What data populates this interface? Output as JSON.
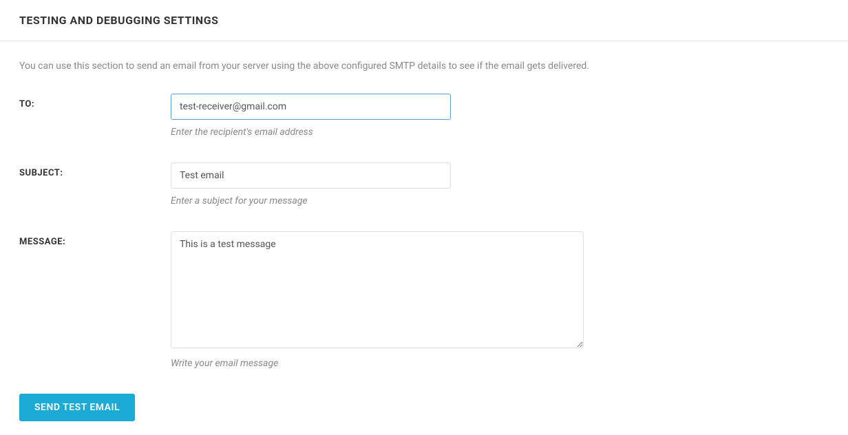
{
  "section": {
    "title": "TESTING AND DEBUGGING SETTINGS",
    "description": "You can use this section to send an email from your server using the above configured SMTP details to see if the email gets delivered."
  },
  "form": {
    "to": {
      "label": "TO:",
      "value": "test-receiver@gmail.com",
      "helper": "Enter the recipient's email address"
    },
    "subject": {
      "label": "SUBJECT:",
      "value": "Test email",
      "helper": "Enter a subject for your message"
    },
    "message": {
      "label": "MESSAGE:",
      "value": "This is a test message",
      "helper": "Write your email message"
    },
    "submit_label": "SEND TEST EMAIL"
  }
}
